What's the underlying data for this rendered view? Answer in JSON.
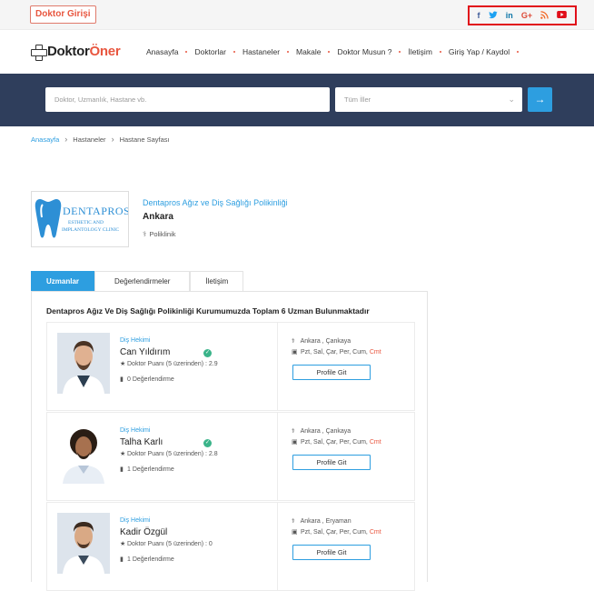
{
  "topbar": {
    "login_label": "Doktor Girişi",
    "social_icons": [
      {
        "name": "facebook-icon",
        "glyph": "f",
        "color": "#3b5998"
      },
      {
        "name": "twitter-icon",
        "glyph": "🐦",
        "color": "#1da1f2"
      },
      {
        "name": "linkedin-icon",
        "glyph": "in",
        "color": "#0e76a8"
      },
      {
        "name": "google-plus-icon",
        "glyph": "G+",
        "color": "#dd4b39"
      },
      {
        "name": "rss-icon",
        "glyph": "◉",
        "color": "#f26522"
      },
      {
        "name": "youtube-icon",
        "glyph": "▶",
        "color": "#e10f1a"
      }
    ]
  },
  "navbar": {
    "logo_part1": "Doktor",
    "logo_part2": "Öner",
    "menu": [
      "Anasayfa",
      "Doktorlar",
      "Hastaneler",
      "Makale",
      "Doktor Musun ?",
      "İletişim",
      "Giriş Yap / Kaydol"
    ]
  },
  "search": {
    "placeholder": "Doktor, Uzmanlık, Hastane vb.",
    "city_select": "Tüm İller",
    "button_icon": "→"
  },
  "breadcrumb": [
    "Anasayfa",
    "Hastaneler",
    "Hastane Sayfası"
  ],
  "clinic": {
    "logo_text_main": "DENTAPROS",
    "logo_text_sub1": "ESTHETIC AND",
    "logo_text_sub2": "IMPLANTOLOGY CLINIC",
    "name": "Dentapros Ağız ve Diş Sağlığı Polikinliği",
    "city": "Ankara",
    "type": "Poliklinik"
  },
  "tabs": [
    "Uzmanlar",
    "Değerlendirmeler",
    "İletişim"
  ],
  "panel_title": "Dentapros Ağız Ve Diş Sağlığı Polikinliği Kurumumuzda Toplam 6 Uzman Bulunmaktadır",
  "doctors": [
    {
      "specialty": "Diş Hekimi",
      "name": "Can Yıldırım",
      "verified": true,
      "score": "Doktor Puanı (5 üzerinden) : 2.9",
      "reviews": "0 Değerlendirme",
      "location": "Ankara , Çankaya",
      "days": "Pzt, Sal, Çar, Per, Cum,",
      "days_weekend": "Cmt",
      "button": "Profile Git"
    },
    {
      "specialty": "Diş Hekimi",
      "name": "Talha Karlı",
      "verified": true,
      "score": "Doktor Puanı (5 üzerinden) : 2.8",
      "reviews": "1 Değerlendirme",
      "location": "Ankara , Çankaya",
      "days": "Pzt, Sal, Çar, Per, Cum,",
      "days_weekend": "Cmt",
      "button": "Profile Git"
    },
    {
      "specialty": "Diş Hekimi",
      "name": "Kadir Özgül",
      "verified": false,
      "score": "Doktor Puanı (5 üzerinden) : 0",
      "reviews": "1 Değerlendirme",
      "location": "Ankara , Eryaman",
      "days": "Pzt, Sal, Çar, Per, Cum,",
      "days_weekend": "Cmt",
      "button": "Profile Git"
    }
  ]
}
